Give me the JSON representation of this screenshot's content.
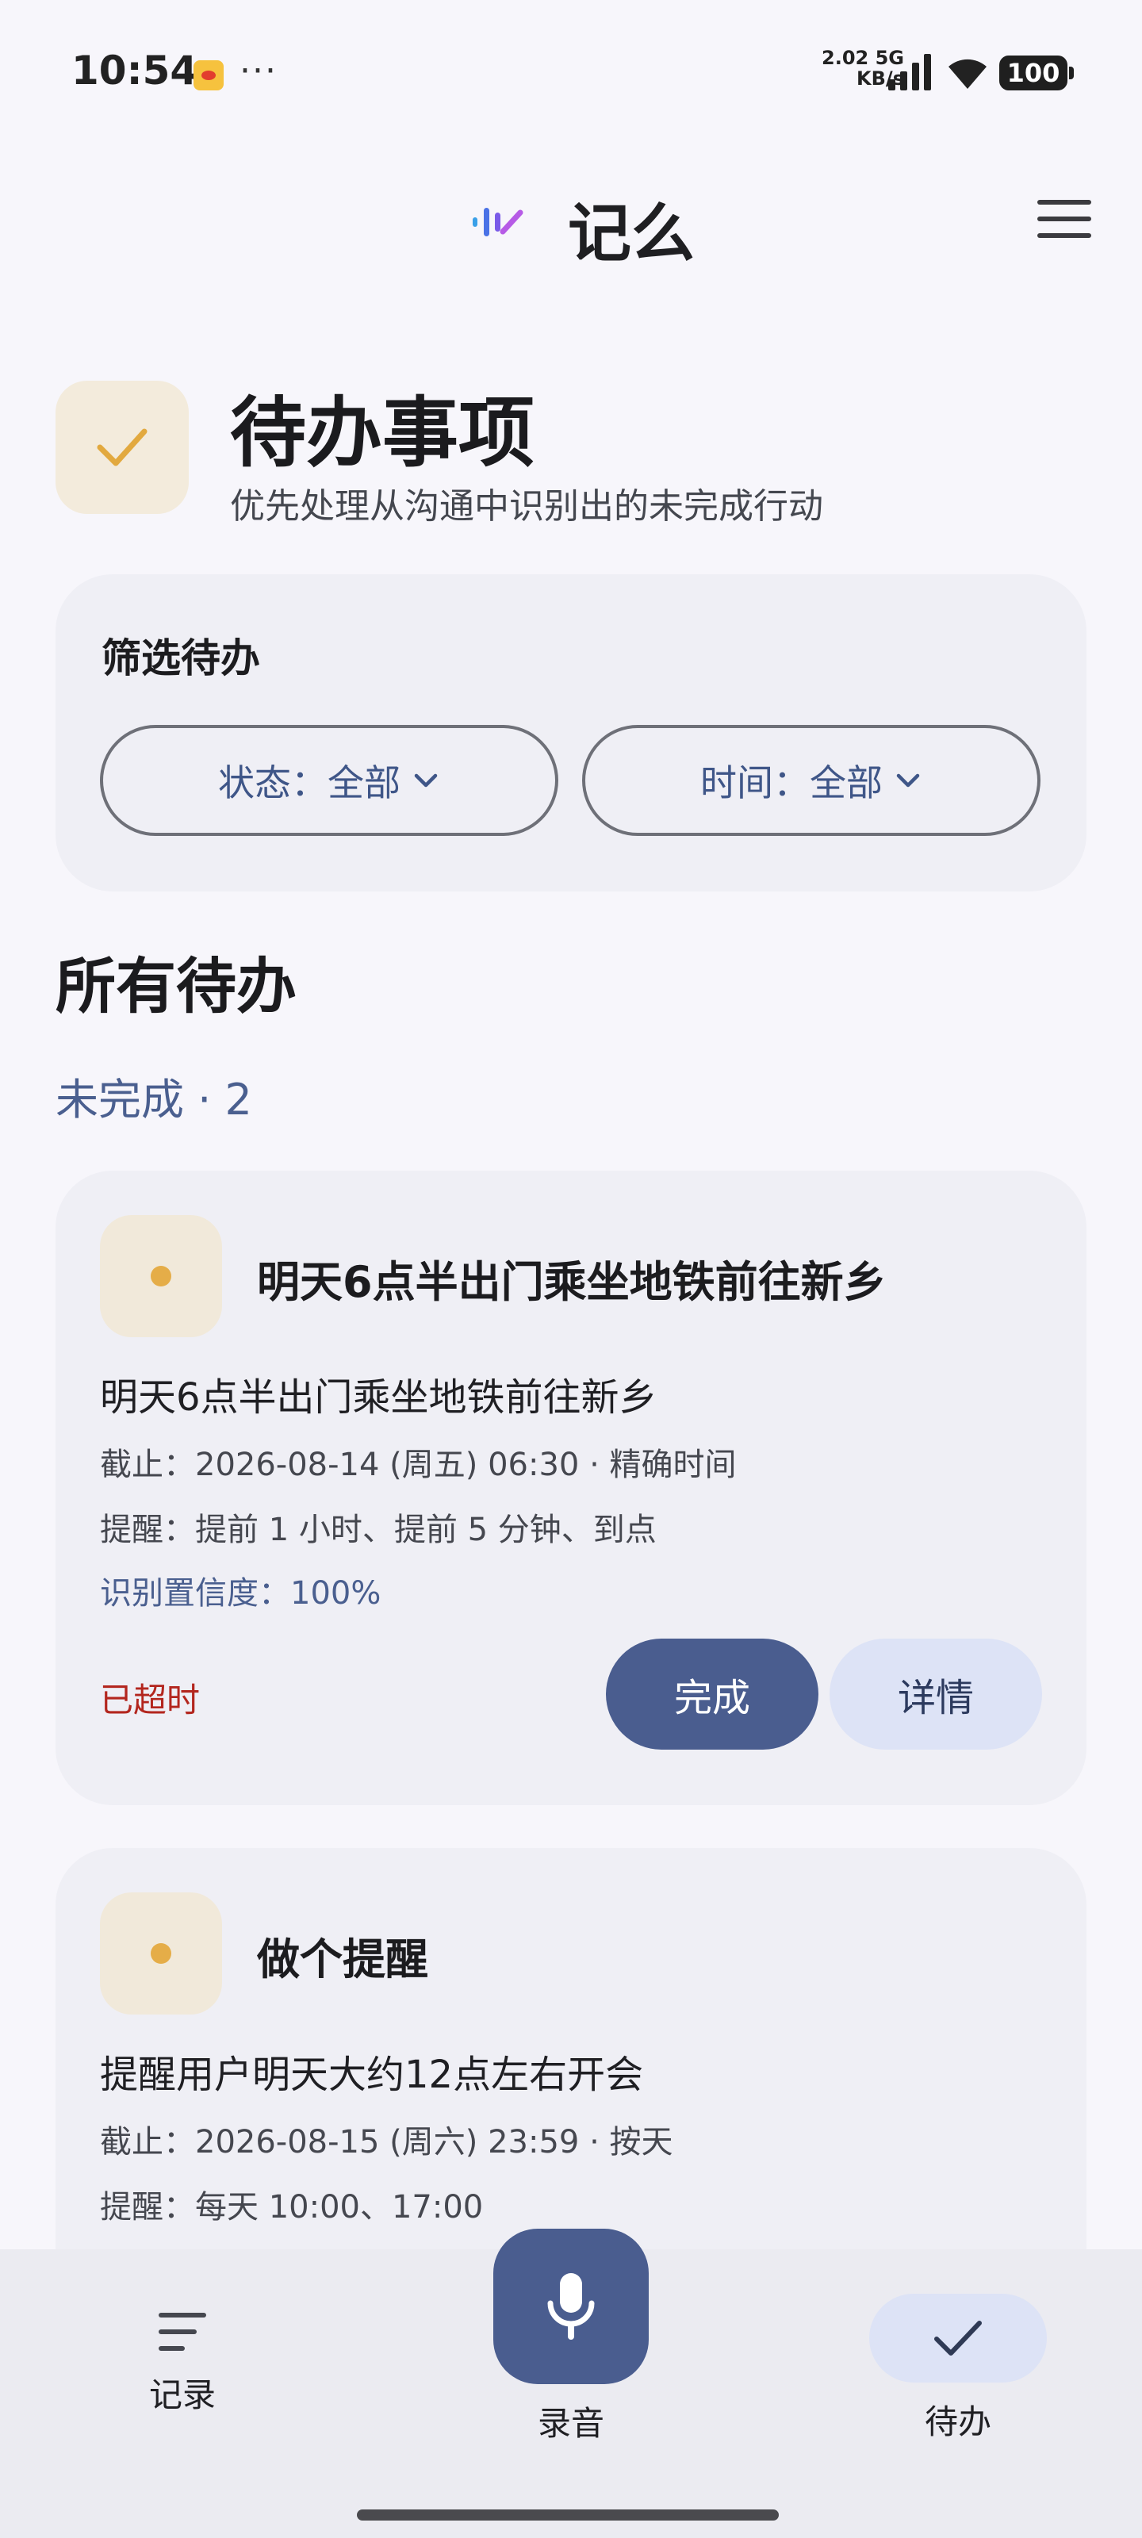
{
  "status_bar": {
    "time": "10:54",
    "dots": "···",
    "network_speed_value": "2.02",
    "network_speed_unit": "KB/s",
    "network_type": "5G",
    "battery": "100"
  },
  "header": {
    "app_name": "记么",
    "logo_icon": "waveform-logo-icon",
    "menu_icon": "hamburger-menu-icon"
  },
  "page": {
    "title": "待办事项",
    "subtitle": "优先处理从沟通中识别出的未完成行动",
    "badge_icon": "check-icon"
  },
  "filter": {
    "title": "筛选待办",
    "status_label": "状态：全部",
    "time_label": "时间：全部"
  },
  "section": {
    "title": "所有待办",
    "group_label": "未完成 · 2"
  },
  "todos": [
    {
      "title": "明天6点半出门乘坐地铁前往新乡",
      "description": "明天6点半出门乘坐地铁前往新乡",
      "deadline": "截止：2026-08-14 (周五) 06:30 · 精确时间",
      "reminder": "提醒：提前 1 小时、提前 5 分钟、到点",
      "confidence": "识别置信度：100%",
      "overdue": "已超时",
      "complete_label": "完成",
      "detail_label": "详情"
    },
    {
      "title": "做个提醒",
      "description": "提醒用户明天大约12点左右开会",
      "deadline": "截止：2026-08-15 (周六) 23:59 · 按天",
      "reminder": "提醒：每天 10:00、17:00"
    }
  ],
  "bottom_nav": {
    "records_label": "记录",
    "record_audio_label": "录音",
    "todos_label": "待办"
  },
  "colors": {
    "primary": "#4a5d8f",
    "accent_gold": "#e5ad48",
    "overdue": "#b3261e",
    "card_bg": "#efeff5"
  }
}
